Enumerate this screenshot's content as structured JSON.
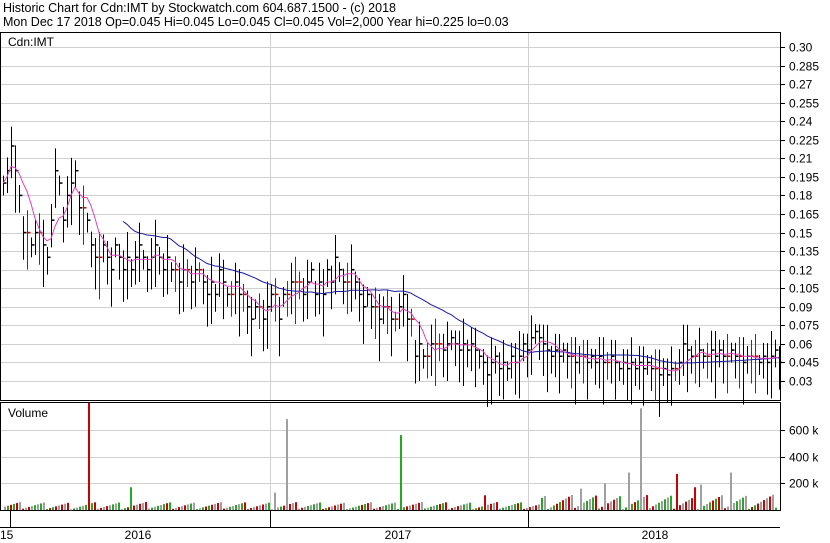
{
  "header": {
    "line1": "Historic Chart for Cdn:IMT by Stockwatch.com 604.687.1500 - (c) 2018",
    "line2": "Mon Dec 17 2018   Op=0.045   Hi=0.045   Lo=0.045   Cl=0.045   Vol=2,000   Year hi=0.225   lo=0.03"
  },
  "colors": {
    "price_bar": "#000000",
    "unchanged_bar": "#cc0000",
    "ma_short": "#e040c0",
    "ma_long": "#1a1aa0",
    "vol_up": "#22aa22",
    "vol_down": "#cc0000",
    "vol_neutral": "#a0a0a0",
    "grid": "#d0d0d0"
  },
  "chart_data": [
    {
      "type": "line",
      "title": "Cdn:IMT",
      "x_labels": [
        "15",
        "2016",
        "2017",
        "2018"
      ],
      "ylim": [
        0.015,
        0.31
      ],
      "y_ticks": [
        "0.30",
        "0.285",
        "0.27",
        "0.255",
        "0.24",
        "0.225",
        "0.21",
        "0.195",
        "0.18",
        "0.165",
        "0.15",
        "0.135",
        "0.12",
        "0.105",
        "0.09",
        "0.075",
        "0.06",
        "0.045",
        "0.03"
      ],
      "grid": true,
      "series": [
        {
          "kind": "price",
          "points": [
            [
              0,
              0.19
            ],
            [
              4,
              0.2
            ],
            [
              8,
              0.22
            ],
            [
              12,
              0.2
            ],
            [
              16,
              0.18
            ],
            [
              20,
              0.15
            ],
            [
              24,
              0.15
            ],
            [
              28,
              0.14
            ],
            [
              32,
              0.15
            ],
            [
              36,
              0.15
            ],
            [
              40,
              0.14
            ],
            [
              44,
              0.13
            ],
            [
              48,
              0.16
            ],
            [
              52,
              0.2
            ],
            [
              56,
              0.19
            ],
            [
              60,
              0.16
            ],
            [
              64,
              0.18
            ],
            [
              68,
              0.19
            ],
            [
              72,
              0.2
            ],
            [
              76,
              0.17
            ],
            [
              80,
              0.17
            ],
            [
              84,
              0.16
            ],
            [
              88,
              0.14
            ],
            [
              92,
              0.13
            ],
            [
              96,
              0.13
            ],
            [
              100,
              0.14
            ],
            [
              104,
              0.13
            ],
            [
              108,
              0.12
            ],
            [
              112,
              0.14
            ],
            [
              116,
              0.13
            ],
            [
              120,
              0.12
            ],
            [
              124,
              0.13
            ],
            [
              128,
              0.12
            ],
            [
              132,
              0.13
            ],
            [
              136,
              0.14
            ],
            [
              140,
              0.13
            ],
            [
              144,
              0.12
            ],
            [
              148,
              0.13
            ],
            [
              152,
              0.14
            ],
            [
              156,
              0.13
            ],
            [
              160,
              0.12
            ],
            [
              164,
              0.13
            ],
            [
              168,
              0.12
            ],
            [
              172,
              0.12
            ],
            [
              176,
              0.11
            ],
            [
              180,
              0.12
            ],
            [
              184,
              0.12
            ],
            [
              188,
              0.11
            ],
            [
              192,
              0.12
            ],
            [
              196,
              0.12
            ],
            [
              200,
              0.11
            ],
            [
              204,
              0.1
            ],
            [
              208,
              0.11
            ],
            [
              212,
              0.1
            ],
            [
              216,
              0.12
            ],
            [
              220,
              0.11
            ],
            [
              224,
              0.1
            ],
            [
              228,
              0.1
            ],
            [
              232,
              0.11
            ],
            [
              236,
              0.1
            ],
            [
              240,
              0.1
            ],
            [
              244,
              0.09
            ],
            [
              248,
              0.08
            ],
            [
              252,
              0.09
            ],
            [
              256,
              0.09
            ],
            [
              260,
              0.08
            ],
            [
              264,
              0.09
            ],
            [
              268,
              0.1
            ],
            [
              272,
              0.1
            ],
            [
              276,
              0.08
            ],
            [
              280,
              0.1
            ],
            [
              284,
              0.1
            ],
            [
              288,
              0.11
            ],
            [
              292,
              0.11
            ],
            [
              296,
              0.11
            ],
            [
              300,
              0.1
            ],
            [
              304,
              0.11
            ],
            [
              308,
              0.12
            ],
            [
              312,
              0.1
            ],
            [
              316,
              0.11
            ],
            [
              320,
              0.1
            ],
            [
              324,
              0.12
            ],
            [
              328,
              0.11
            ],
            [
              332,
              0.13
            ],
            [
              336,
              0.12
            ],
            [
              340,
              0.11
            ],
            [
              344,
              0.11
            ],
            [
              348,
              0.12
            ],
            [
              352,
              0.11
            ],
            [
              356,
              0.1
            ],
            [
              360,
              0.09
            ],
            [
              364,
              0.1
            ],
            [
              368,
              0.09
            ],
            [
              372,
              0.09
            ],
            [
              376,
              0.08
            ],
            [
              380,
              0.09
            ],
            [
              384,
              0.09
            ],
            [
              388,
              0.08
            ],
            [
              392,
              0.08
            ],
            [
              396,
              0.09
            ],
            [
              400,
              0.1
            ],
            [
              404,
              0.08
            ],
            [
              408,
              0.08
            ],
            [
              412,
              0.05
            ],
            [
              416,
              0.06
            ],
            [
              420,
              0.05
            ],
            [
              424,
              0.05
            ],
            [
              428,
              0.06
            ],
            [
              432,
              0.06
            ],
            [
              436,
              0.06
            ],
            [
              440,
              0.055
            ],
            [
              444,
              0.06
            ],
            [
              448,
              0.065
            ],
            [
              452,
              0.06
            ],
            [
              456,
              0.055
            ],
            [
              460,
              0.06
            ],
            [
              464,
              0.055
            ],
            [
              468,
              0.06
            ],
            [
              472,
              0.055
            ],
            [
              476,
              0.05
            ],
            [
              480,
              0.045
            ],
            [
              484,
              0.035
            ],
            [
              488,
              0.045
            ],
            [
              492,
              0.05
            ],
            [
              496,
              0.04
            ],
            [
              500,
              0.045
            ],
            [
              504,
              0.04
            ],
            [
              508,
              0.05
            ],
            [
              512,
              0.045
            ],
            [
              516,
              0.05
            ],
            [
              520,
              0.06
            ],
            [
              524,
              0.055
            ],
            [
              528,
              0.065
            ],
            [
              532,
              0.07
            ],
            [
              536,
              0.065
            ],
            [
              540,
              0.06
            ],
            [
              544,
              0.055
            ],
            [
              548,
              0.05
            ],
            [
              552,
              0.055
            ],
            [
              556,
              0.05
            ],
            [
              560,
              0.055
            ],
            [
              564,
              0.05
            ],
            [
              568,
              0.05
            ],
            [
              572,
              0.045
            ],
            [
              576,
              0.05
            ],
            [
              580,
              0.05
            ],
            [
              584,
              0.045
            ],
            [
              588,
              0.05
            ],
            [
              592,
              0.045
            ],
            [
              596,
              0.05
            ],
            [
              600,
              0.045
            ],
            [
              604,
              0.045
            ],
            [
              608,
              0.05
            ],
            [
              612,
              0.045
            ],
            [
              616,
              0.04
            ],
            [
              620,
              0.045
            ],
            [
              624,
              0.04
            ],
            [
              628,
              0.045
            ],
            [
              632,
              0.04
            ],
            [
              636,
              0.045
            ],
            [
              640,
              0.04
            ],
            [
              644,
              0.045
            ],
            [
              648,
              0.04
            ],
            [
              652,
              0.04
            ],
            [
              656,
              0.035
            ],
            [
              660,
              0.04
            ],
            [
              664,
              0.035
            ],
            [
              668,
              0.04
            ],
            [
              672,
              0.04
            ],
            [
              676,
              0.045
            ],
            [
              680,
              0.06
            ],
            [
              684,
              0.055
            ],
            [
              688,
              0.05
            ],
            [
              692,
              0.05
            ],
            [
              696,
              0.055
            ],
            [
              700,
              0.05
            ],
            [
              704,
              0.05
            ],
            [
              708,
              0.055
            ],
            [
              712,
              0.05
            ],
            [
              716,
              0.055
            ],
            [
              720,
              0.05
            ],
            [
              724,
              0.05
            ],
            [
              728,
              0.055
            ],
            [
              732,
              0.05
            ],
            [
              736,
              0.05
            ],
            [
              740,
              0.045
            ],
            [
              744,
              0.05
            ],
            [
              748,
              0.05
            ],
            [
              752,
              0.05
            ],
            [
              756,
              0.045
            ],
            [
              760,
              0.05
            ],
            [
              764,
              0.045
            ],
            [
              768,
              0.05
            ],
            [
              772,
              0.055
            ],
            [
              776,
              0.045
            ]
          ]
        }
      ]
    },
    {
      "type": "bar",
      "title": "Volume",
      "y_ticks": [
        "600 k",
        "400 k",
        "200 k"
      ],
      "ylim": [
        0,
        800000
      ]
    }
  ]
}
